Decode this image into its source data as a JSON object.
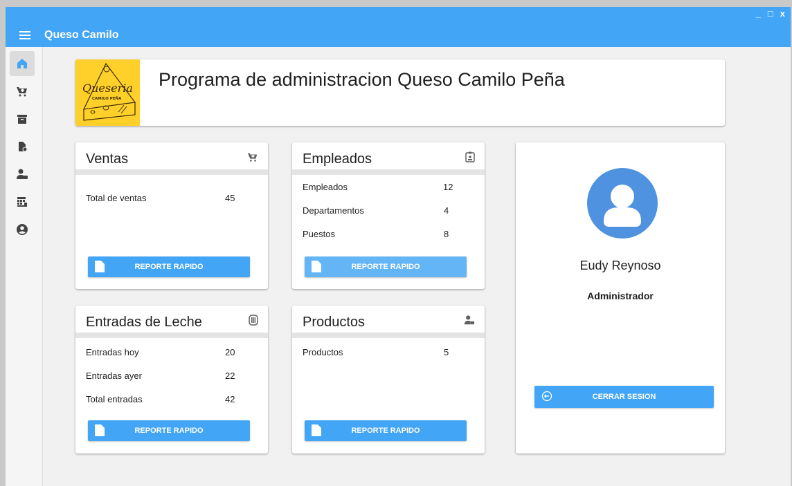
{
  "window": {
    "minimize_label": "_",
    "maximize_label": "□",
    "close_label": "x"
  },
  "appbar": {
    "title": "Queso Camilo"
  },
  "sidebar": {
    "items": [
      {
        "icon": "home-icon",
        "active": true
      },
      {
        "icon": "cart-icon",
        "active": false
      },
      {
        "icon": "archive-icon",
        "active": false
      },
      {
        "icon": "document-icon",
        "active": false
      },
      {
        "icon": "user-badge-icon",
        "active": false
      },
      {
        "icon": "warehouse-icon",
        "active": false
      },
      {
        "icon": "account-circle-icon",
        "active": false
      }
    ]
  },
  "header": {
    "logo": {
      "main_text": "Queseria",
      "sub_text": "CAMILO PEÑA"
    },
    "title": "Programa de administracion Queso Camilo Peña"
  },
  "cards": {
    "ventas": {
      "title": "Ventas",
      "icon": "cart-icon",
      "rows": [
        {
          "label": "Total de ventas",
          "value": "45"
        }
      ],
      "button_label": "REPORTE RAPIDO"
    },
    "empleados": {
      "title": "Empleados",
      "icon": "id-badge-icon",
      "rows": [
        {
          "label": "Empleados",
          "value": "12"
        },
        {
          "label": "Departamentos",
          "value": "4"
        },
        {
          "label": "Puestos",
          "value": "8"
        }
      ],
      "button_label": "REPORTE RAPIDO"
    },
    "leche": {
      "title": "Entradas de Leche",
      "icon": "barrel-icon",
      "rows": [
        {
          "label": "Entradas hoy",
          "value": "20"
        },
        {
          "label": "Entradas ayer",
          "value": "22"
        },
        {
          "label": "Total entradas",
          "value": "42"
        }
      ],
      "button_label": "REPORTE RAPIDO"
    },
    "productos": {
      "title": "Productos",
      "icon": "user-badge-icon",
      "rows": [
        {
          "label": "Productos",
          "value": "5"
        }
      ],
      "button_label": "REPORTE RAPIDO"
    }
  },
  "profile": {
    "avatar_icon": "account-circle-icon",
    "name": "Eudy Reynoso",
    "role": "Administrador",
    "logout_label": "CERRAR SESION"
  },
  "colors": {
    "primary": "#42a5f5",
    "primary_light": "#64b5f6",
    "avatar": "#4f92e0",
    "logo_bg": "#ffd02a",
    "sidebar_icon": "#424242",
    "active_icon": "#42a5f5"
  }
}
